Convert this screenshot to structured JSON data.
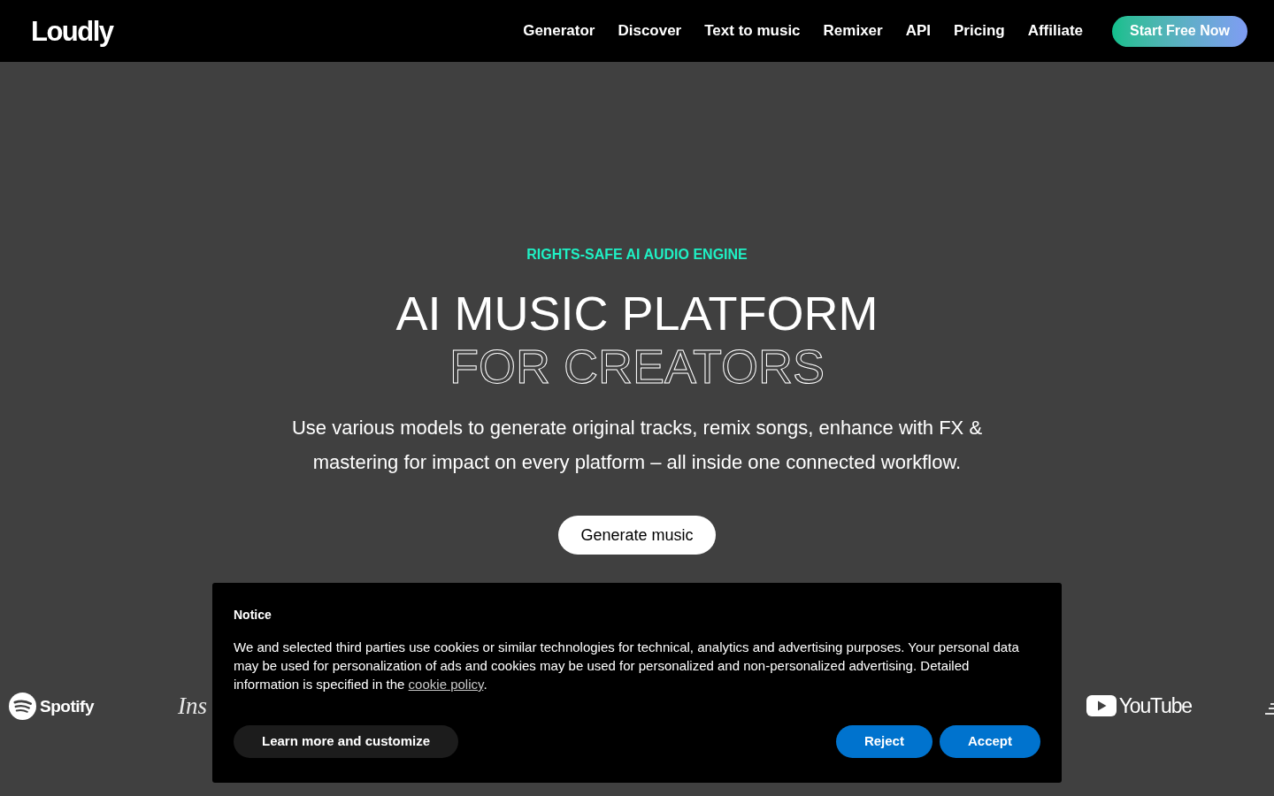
{
  "header": {
    "logo": "Loudly",
    "nav": [
      {
        "label": "Generator"
      },
      {
        "label": "Discover"
      },
      {
        "label": "Text to music"
      },
      {
        "label": "Remixer"
      },
      {
        "label": "API"
      },
      {
        "label": "Pricing"
      },
      {
        "label": "Affiliate"
      }
    ],
    "cta": "Start Free Now"
  },
  "hero": {
    "eyebrow": "RIGHTS-SAFE AI AUDIO ENGINE",
    "title": "AI MUSIC PLATFORM",
    "title_outline": "FOR CREATORS",
    "description": "Use various models to generate original tracks, remix songs, enhance with FX & mastering for impact on every platform – all inside one connected workflow.",
    "button": "Generate music"
  },
  "logos": [
    {
      "kind": "spotify",
      "label": "Spotify"
    },
    {
      "kind": "script",
      "label": "Ins"
    },
    {
      "kind": "youtube",
      "label": "YouTube"
    },
    {
      "kind": "partial"
    }
  ],
  "cookie_notice": {
    "title": "Notice",
    "text_before": "We and selected third parties use cookies or similar technologies for technical, analytics and advertising purposes. Your personal data may be used for personalization of ads and cookies may be used for personalized and non-personalized advertising. Detailed information is specified in the ",
    "link": "cookie policy",
    "text_after": ".",
    "buttons": [
      {
        "kind": "secondary",
        "label": "Learn more and customize"
      },
      {
        "kind": "primary",
        "label": "Reject"
      },
      {
        "kind": "primary",
        "label": "Accept"
      }
    ]
  }
}
